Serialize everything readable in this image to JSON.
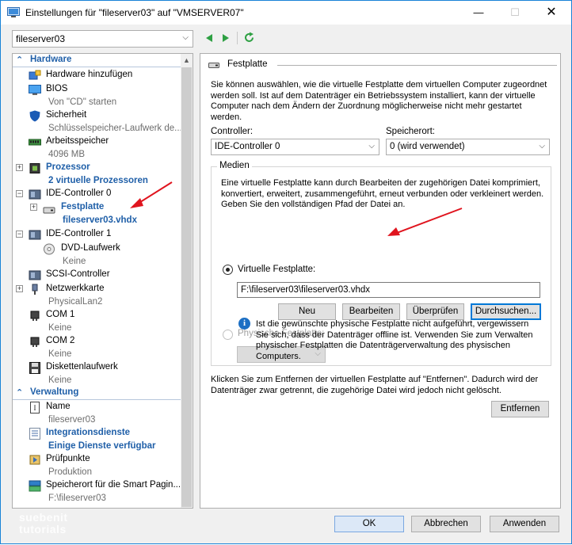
{
  "window": {
    "title": "Einstellungen für \"fileserver03\" auf \"VMSERVER07\"",
    "controls": {
      "minimize": "—",
      "maximize": "☐",
      "close": "✕"
    }
  },
  "toolbar": {
    "vm_select": "fileserver03"
  },
  "sidebar": {
    "hardware_section": "Hardware",
    "management_section": "Verwaltung",
    "items": [
      {
        "label": "Hardware hinzufügen",
        "sub": ""
      },
      {
        "label": "BIOS",
        "sub": "Von \"CD\" starten"
      },
      {
        "label": "Sicherheit",
        "sub": "Schlüsselspeicher-Laufwerk de..."
      },
      {
        "label": "Arbeitsspeicher",
        "sub": "4096 MB"
      },
      {
        "label": "Prozessor",
        "sub": "2 virtuelle Prozessoren"
      },
      {
        "label": "IDE-Controller 0",
        "sub": ""
      },
      {
        "label": "Festplatte",
        "sub": "fileserver03.vhdx"
      },
      {
        "label": "IDE-Controller 1",
        "sub": ""
      },
      {
        "label": "DVD-Laufwerk",
        "sub": "Keine"
      },
      {
        "label": "SCSI-Controller",
        "sub": ""
      },
      {
        "label": "Netzwerkkarte",
        "sub": "PhysicalLan2"
      },
      {
        "label": "COM 1",
        "sub": "Keine"
      },
      {
        "label": "COM 2",
        "sub": "Keine"
      },
      {
        "label": "Diskettenlaufwerk",
        "sub": "Keine"
      },
      {
        "label": "Name",
        "sub": "fileserver03"
      },
      {
        "label": "Integrationsdienste",
        "sub": "Einige Dienste verfügbar"
      },
      {
        "label": "Prüfpunkte",
        "sub": "Produktion"
      },
      {
        "label": "Speicherort für die Smart Pagin...",
        "sub": "F:\\fileserver03"
      }
    ]
  },
  "panel": {
    "header": "Festplatte",
    "description": "Sie können auswählen, wie die virtuelle Festplatte dem virtuellen Computer zugeordnet werden soll. Ist auf dem Datenträger ein Betriebssystem installiert, kann der virtuelle Computer nach dem Ändern der Zuordnung möglicherweise nicht mehr gestartet werden.",
    "controller_label": "Controller:",
    "controller_value": "IDE-Controller 0",
    "location_label": "Speicherort:",
    "location_value": "0 (wird verwendet)",
    "media": {
      "label": "Medien",
      "description": "Eine virtuelle Festplatte kann durch Bearbeiten der zugehörigen Datei komprimiert, konvertiert, erweitert, zusammengeführt, erneut verbunden oder verkleinert werden. Geben Sie den vollständigen Pfad der Datei an.",
      "virtual_disk_label": "Virtuelle Festplatte:",
      "path": "F:\\fileserver03\\fileserver03.vhdx",
      "btn_new": "Neu",
      "btn_edit": "Bearbeiten",
      "btn_check": "Überprüfen",
      "btn_browse": "Durchsuchen...",
      "physical_disk_label": "Physische Festplatte:",
      "physical_value": "",
      "info": "Ist die gewünschte physische Festplatte nicht aufgeführt, vergewissern Sie sich, dass der Datenträger offline ist. Verwenden Sie zum Verwalten physischer Festplatten die Datenträgerverwaltung des physischen Computers."
    },
    "remove_description": "Klicken Sie zum Entfernen der virtuellen Festplatte auf \"Entfernen\". Dadurch wird der Datenträger zwar getrennt, die zugehörige Datei wird jedoch nicht gelöscht.",
    "btn_remove": "Entfernen"
  },
  "footer": {
    "ok": "OK",
    "cancel": "Abbrechen",
    "apply": "Anwenden"
  },
  "watermark": {
    "line1": "suebenit",
    "line2": "tutorials"
  },
  "colors": {
    "accent": "#1f5fa8",
    "annotation_arrow": "#e0141e",
    "focus": "#0078d7"
  }
}
